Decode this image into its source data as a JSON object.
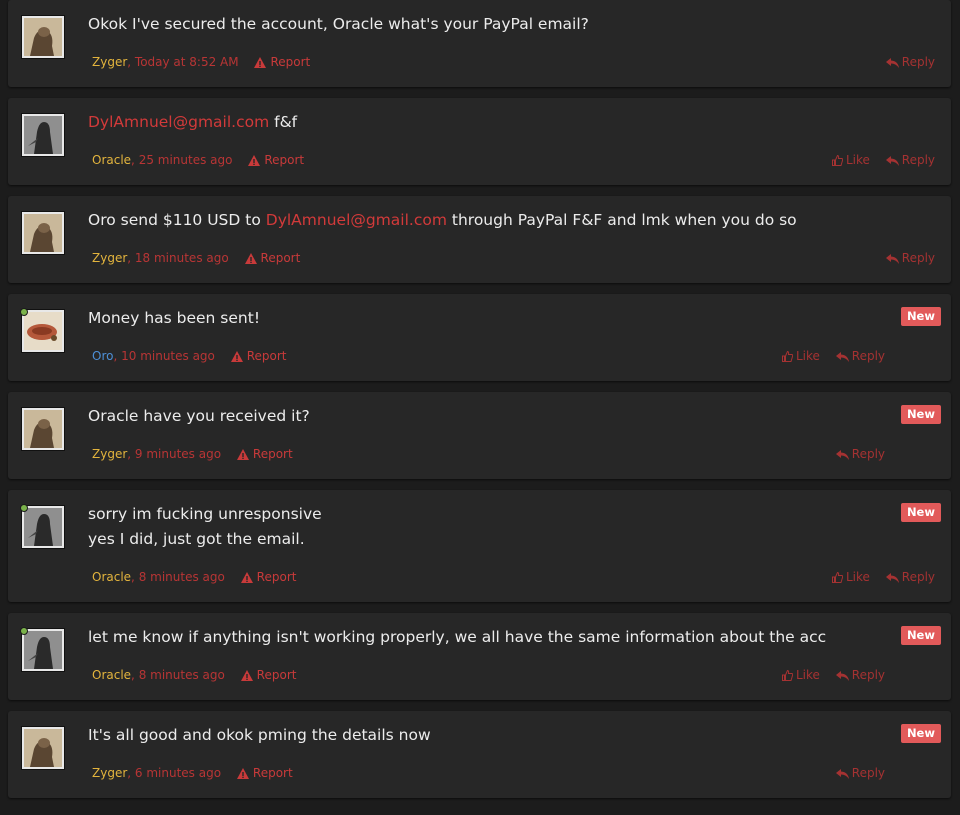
{
  "labels": {
    "report": "Report",
    "like": "Like",
    "reply": "Reply",
    "new": "New"
  },
  "posts": [
    {
      "user": "Zyger",
      "time": "Today at 8:52 AM",
      "text_before": "Okok I've secured the account, Oracle what's your PayPal email?",
      "email": "",
      "text_after": "",
      "line2": ""
    },
    {
      "user": "Oracle",
      "time": "25 minutes ago",
      "text_before": "",
      "email": "DylAmnuel@gmail.com",
      "text_after": " f&f",
      "line2": ""
    },
    {
      "user": "Zyger",
      "time": "18 minutes ago",
      "text_before": "Oro send $110 USD to ",
      "email": "DylAmnuel@gmail.com",
      "text_after": " through PayPal F&F and lmk when you do so",
      "line2": ""
    },
    {
      "user": "Oro",
      "time": "10 minutes ago",
      "text_before": "Money has been sent!",
      "email": "",
      "text_after": "",
      "line2": ""
    },
    {
      "user": "Zyger",
      "time": "9 minutes ago",
      "text_before": "Oracle have you received it?",
      "email": "",
      "text_after": "",
      "line2": ""
    },
    {
      "user": "Oracle",
      "time": "8 minutes ago",
      "text_before": "sorry im fucking unresponsive",
      "email": "",
      "text_after": "",
      "line2": "yes I did, just got the email."
    },
    {
      "user": "Oracle",
      "time": "8 minutes ago",
      "text_before": "let me know if anything isn't working properly, we all have the same information about the acc",
      "email": "",
      "text_after": "",
      "line2": ""
    },
    {
      "user": "Zyger",
      "time": "6 minutes ago",
      "text_before": "It's all good and okok pming the details now",
      "email": "",
      "text_after": "",
      "line2": ""
    }
  ]
}
